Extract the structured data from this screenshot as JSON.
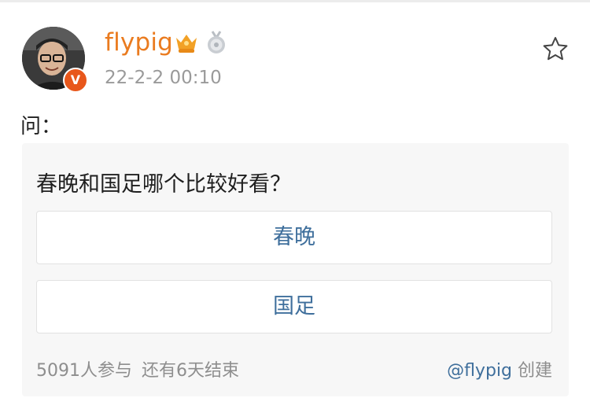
{
  "post": {
    "username": "flypig",
    "timestamp": "22-2-2 00:10",
    "text": "问：",
    "verified_mark": "V",
    "icons": {
      "avatar": "user-avatar",
      "verified": "verified-badge-icon",
      "crown": "crown-badge-icon",
      "medal": "medal-badge-icon",
      "favorite": "star-icon"
    }
  },
  "poll": {
    "question": "春晚和国足哪个比较好看？",
    "options": [
      {
        "label": "春晚"
      },
      {
        "label": "国足"
      }
    ],
    "participants": "5091人参与",
    "ends_in": "还有6天结束",
    "creator": "@flypig",
    "created_label": "创建"
  },
  "colors": {
    "username": "#ea7b1f",
    "link": "#3f6f9c",
    "verified": "#e8571b",
    "card_bg": "#f7f7f7"
  }
}
